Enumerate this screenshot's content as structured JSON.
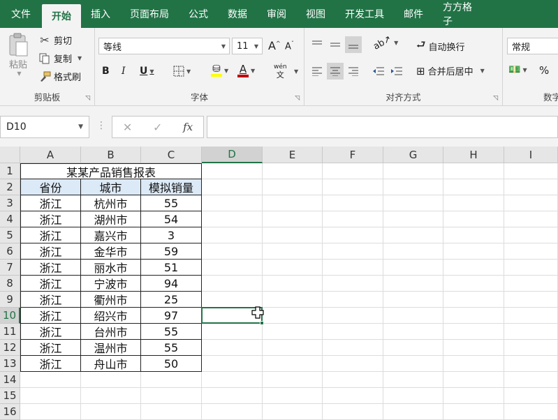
{
  "tabs": [
    {
      "label": "文件",
      "active": false
    },
    {
      "label": "开始",
      "active": true
    },
    {
      "label": "插入",
      "active": false
    },
    {
      "label": "页面布局",
      "active": false
    },
    {
      "label": "公式",
      "active": false
    },
    {
      "label": "数据",
      "active": false
    },
    {
      "label": "审阅",
      "active": false
    },
    {
      "label": "视图",
      "active": false
    },
    {
      "label": "开发工具",
      "active": false
    },
    {
      "label": "邮件",
      "active": false
    },
    {
      "label": "方方格子",
      "active": false
    }
  ],
  "ribbon": {
    "clipboard": {
      "group_label": "剪贴板",
      "paste": "粘贴",
      "cut": "剪切",
      "copy": "复制",
      "format_painter": "格式刷"
    },
    "font": {
      "group_label": "字体",
      "font_name": "等线",
      "font_size": "11",
      "bold": "B",
      "italic": "I",
      "underline": "U",
      "phonetic_top": "wén",
      "phonetic_bottom": "文"
    },
    "alignment": {
      "group_label": "对齐方式",
      "wrap_text": "自动换行",
      "merge_center": "合并后居中"
    },
    "number": {
      "group_label": "数字",
      "number_format": "常规",
      "percent": "%"
    }
  },
  "formula_bar": {
    "name_box": "D10",
    "fx_label": "fx",
    "formula": ""
  },
  "columns": [
    "A",
    "B",
    "C",
    "D",
    "E",
    "F",
    "G",
    "H",
    "I"
  ],
  "rows": [
    "1",
    "2",
    "3",
    "4",
    "5",
    "6",
    "7",
    "8",
    "9",
    "10",
    "11",
    "12",
    "13",
    "14",
    "15",
    "16"
  ],
  "active_cell": {
    "col": "D",
    "row": "10"
  },
  "sheet": {
    "title": "某某产品销售报表",
    "headers": [
      "省份",
      "城市",
      "模拟销量"
    ],
    "data": [
      [
        "浙江",
        "杭州市",
        "55"
      ],
      [
        "浙江",
        "湖州市",
        "54"
      ],
      [
        "浙江",
        "嘉兴市",
        "3"
      ],
      [
        "浙江",
        "金华市",
        "59"
      ],
      [
        "浙江",
        "丽水市",
        "51"
      ],
      [
        "浙江",
        "宁波市",
        "94"
      ],
      [
        "浙江",
        "衢州市",
        "25"
      ],
      [
        "浙江",
        "绍兴市",
        "97"
      ],
      [
        "浙江",
        "台州市",
        "55"
      ],
      [
        "浙江",
        "温州市",
        "55"
      ],
      [
        "浙江",
        "舟山市",
        "50"
      ]
    ]
  },
  "colors": {
    "accent": "#217346",
    "header_fill": "#dce9f6"
  }
}
